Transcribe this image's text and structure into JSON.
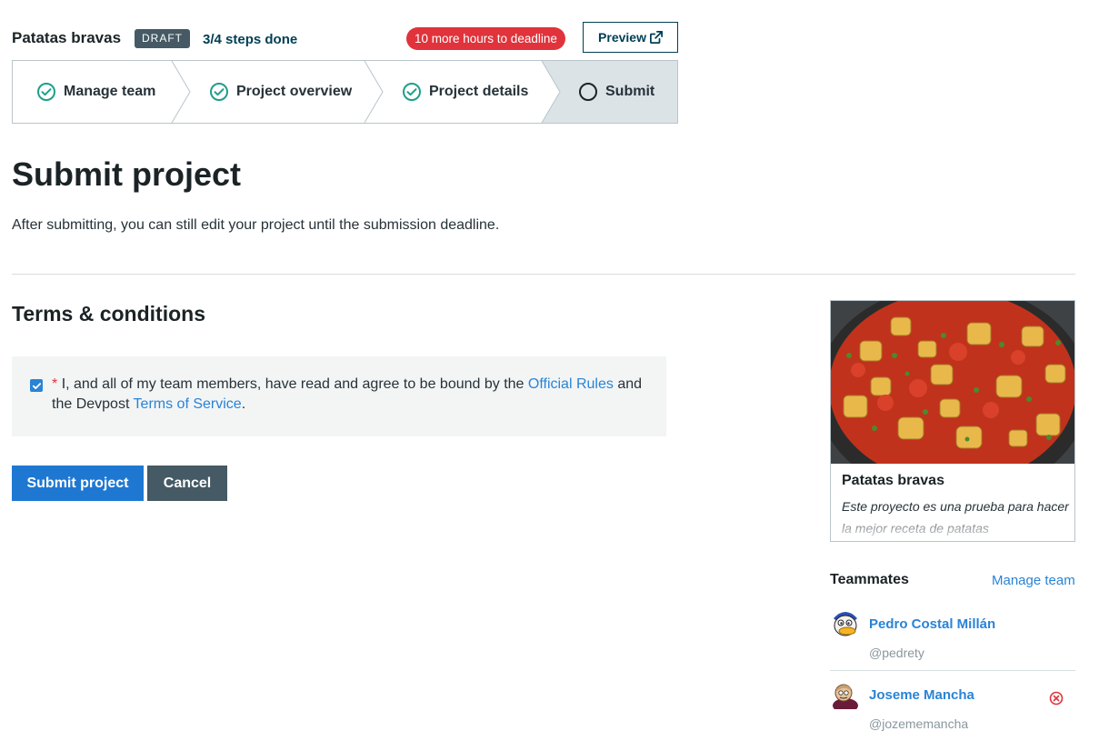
{
  "header": {
    "project_name": "Patatas bravas",
    "draft_label": "DRAFT",
    "steps_done": "3/4 steps done",
    "deadline": "10 more hours to deadline",
    "preview_label": "Preview"
  },
  "stepper": {
    "steps": [
      {
        "label": "Manage team",
        "done": true
      },
      {
        "label": "Project overview",
        "done": true
      },
      {
        "label": "Project details",
        "done": true
      },
      {
        "label": "Submit",
        "done": false,
        "active": true
      }
    ]
  },
  "main": {
    "title": "Submit project",
    "subtitle": "After submitting, you can still edit your project until the submission deadline.",
    "terms_title": "Terms & conditions",
    "terms": {
      "checked": true,
      "required_mark": "*",
      "text_1": "I, and all of my team members, have read and agree to be bound by the",
      "link_1": "Official Rules",
      "text_2": "and the Devpost",
      "link_2": "Terms of Service",
      "text_3": "."
    },
    "submit_label": "Submit project",
    "cancel_label": "Cancel"
  },
  "card": {
    "title": "Patatas bravas",
    "description": "Este proyecto es una prueba para hacer la mejor receta de patatas"
  },
  "teammates": {
    "title": "Teammates",
    "manage_label": "Manage team",
    "members": [
      {
        "name": "Pedro Costal Millán",
        "handle": "@pedrety"
      },
      {
        "name": "Joseme Mancha",
        "handle": "@jozememancha"
      }
    ]
  },
  "colors": {
    "accent": "#2a83d6",
    "primary_button": "#1e78d2",
    "dark": "#455a64",
    "danger": "#e0333b",
    "success": "#1f9e8a"
  }
}
